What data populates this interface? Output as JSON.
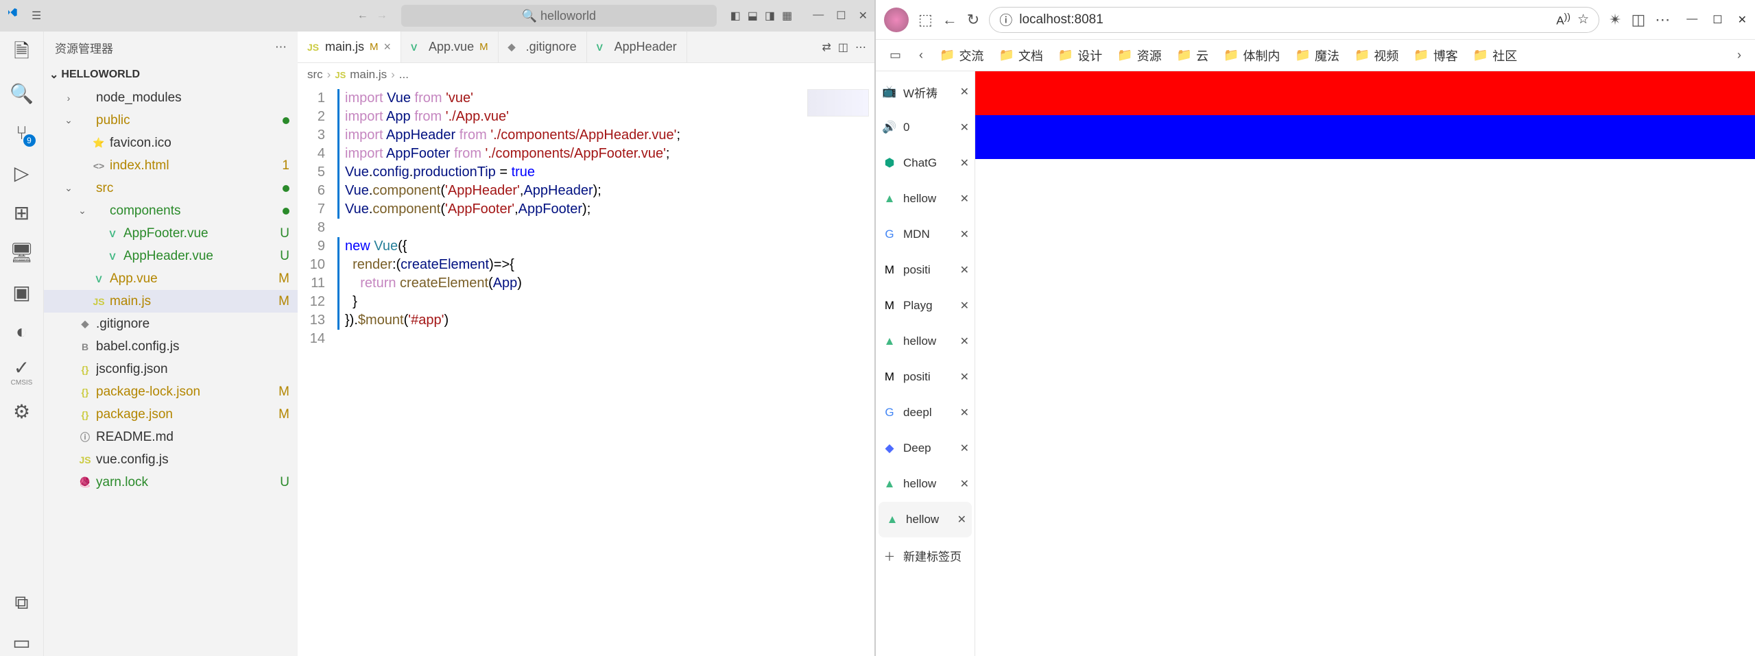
{
  "vscode": {
    "titlebar": {
      "search_placeholder": "helloworld"
    },
    "sidebar": {
      "title": "资源管理器",
      "root": "HELLOWORLD",
      "tree": [
        {
          "indent": 1,
          "chev": "right",
          "icon": "",
          "label": "node_modules",
          "badge": "",
          "class": ""
        },
        {
          "indent": 1,
          "chev": "down",
          "icon": "",
          "label": "public",
          "badge": "dot",
          "class": "git-m"
        },
        {
          "indent": 2,
          "chev": "",
          "icon": "⭐",
          "label": "favicon.ico",
          "badge": "",
          "class": ""
        },
        {
          "indent": 2,
          "chev": "",
          "icon": "<>",
          "label": "index.html",
          "badge": "1",
          "class": "git-m"
        },
        {
          "indent": 1,
          "chev": "down",
          "icon": "",
          "label": "src",
          "badge": "dot",
          "class": "git-m"
        },
        {
          "indent": 2,
          "chev": "down",
          "icon": "",
          "label": "components",
          "badge": "dot",
          "class": "git-u"
        },
        {
          "indent": 3,
          "chev": "",
          "icon": "V",
          "label": "AppFooter.vue",
          "badge": "U",
          "class": "git-u"
        },
        {
          "indent": 3,
          "chev": "",
          "icon": "V",
          "label": "AppHeader.vue",
          "badge": "U",
          "class": "git-u"
        },
        {
          "indent": 2,
          "chev": "",
          "icon": "V",
          "label": "App.vue",
          "badge": "M",
          "class": "git-m"
        },
        {
          "indent": 2,
          "chev": "",
          "icon": "JS",
          "label": "main.js",
          "badge": "M",
          "class": "git-m",
          "selected": true
        },
        {
          "indent": 1,
          "chev": "",
          "icon": "◆",
          "label": ".gitignore",
          "badge": "",
          "class": ""
        },
        {
          "indent": 1,
          "chev": "",
          "icon": "B",
          "label": "babel.config.js",
          "badge": "",
          "class": ""
        },
        {
          "indent": 1,
          "chev": "",
          "icon": "{}",
          "label": "jsconfig.json",
          "badge": "",
          "class": ""
        },
        {
          "indent": 1,
          "chev": "",
          "icon": "{}",
          "label": "package-lock.json",
          "badge": "M",
          "class": "git-m"
        },
        {
          "indent": 1,
          "chev": "",
          "icon": "{}",
          "label": "package.json",
          "badge": "M",
          "class": "git-m"
        },
        {
          "indent": 1,
          "chev": "",
          "icon": "ⓘ",
          "label": "README.md",
          "badge": "",
          "class": ""
        },
        {
          "indent": 1,
          "chev": "",
          "icon": "JS",
          "label": "vue.config.js",
          "badge": "",
          "class": ""
        },
        {
          "indent": 1,
          "chev": "",
          "icon": "🧶",
          "label": "yarn.lock",
          "badge": "U",
          "class": "git-u"
        }
      ]
    },
    "activity_badge": "9",
    "tabs": [
      {
        "icon": "JS",
        "icon_color": "#cbcb41",
        "label": "main.js",
        "status": "M",
        "close": true,
        "active": true
      },
      {
        "icon": "V",
        "icon_color": "#41b883",
        "label": "App.vue",
        "status": "M",
        "close": false,
        "active": false
      },
      {
        "icon": "◆",
        "icon_color": "#888",
        "label": ".gitignore",
        "status": "",
        "close": false,
        "active": false
      },
      {
        "icon": "V",
        "icon_color": "#41b883",
        "label": "AppHeader",
        "status": "",
        "close": false,
        "active": false,
        "overflow": true
      }
    ],
    "breadcrumb": [
      "src",
      "main.js",
      "..."
    ],
    "breadcrumb_icons": [
      "",
      "JS",
      ""
    ],
    "code": {
      "lines": [
        {
          "n": 1,
          "mod": true,
          "html": "<span class='tok-kw'>import</span> <span class='tok-var'>Vue</span> <span class='tok-kw'>from</span> <span class='tok-str'>'vue'</span>"
        },
        {
          "n": 2,
          "mod": true,
          "html": "<span class='tok-kw'>import</span> <span class='tok-var'>App</span> <span class='tok-kw'>from</span> <span class='tok-str'>'./App.vue'</span>"
        },
        {
          "n": 3,
          "mod": true,
          "html": "<span class='tok-kw'>import</span> <span class='tok-var'>AppHeader</span> <span class='tok-kw'>from</span> <span class='tok-str'>'./components/AppHeader.vue'</span>;"
        },
        {
          "n": 4,
          "mod": true,
          "html": "<span class='tok-kw'>import</span> <span class='tok-var'>AppFooter</span> <span class='tok-kw'>from</span> <span class='tok-str'>'./components/AppFooter.vue'</span>;"
        },
        {
          "n": 5,
          "mod": true,
          "html": "<span class='tok-var'>Vue</span>.<span class='tok-prop'>config</span>.<span class='tok-prop'>productionTip</span> = <span class='tok-bool'>true</span>"
        },
        {
          "n": 6,
          "mod": true,
          "html": "<span class='tok-var'>Vue</span>.<span class='tok-fn'>component</span>(<span class='tok-str'>'AppHeader'</span>,<span class='tok-var'>AppHeader</span>);"
        },
        {
          "n": 7,
          "mod": true,
          "html": "<span class='tok-var'>Vue</span>.<span class='tok-fn'>component</span>(<span class='tok-str'>'AppFooter'</span>,<span class='tok-var'>AppFooter</span>);"
        },
        {
          "n": 8,
          "mod": false,
          "html": ""
        },
        {
          "n": 9,
          "mod": true,
          "html": "<span class='tok-new'>new</span> <span class='tok-mod'>Vue</span>({"
        },
        {
          "n": 10,
          "mod": true,
          "html": "  <span class='tok-fn'>render</span>:(<span class='tok-var'>createElement</span>)=&gt;{"
        },
        {
          "n": 11,
          "mod": true,
          "html": "    <span class='tok-kw'>return</span> <span class='tok-fn'>createElement</span>(<span class='tok-var'>App</span>)"
        },
        {
          "n": 12,
          "mod": true,
          "html": "  }"
        },
        {
          "n": 13,
          "mod": true,
          "html": "}).<span class='tok-fn'>$mount</span>(<span class='tok-str'>'#app'</span>)"
        },
        {
          "n": 14,
          "mod": false,
          "html": ""
        }
      ]
    }
  },
  "browser": {
    "url": "localhost:8081",
    "bookmarks": [
      "交流",
      "文档",
      "设计",
      "资源",
      "云",
      "体制内",
      "魔法",
      "视频",
      "博客",
      "社区"
    ],
    "vtabs": [
      {
        "icon": "📺",
        "color": "#00a1d6",
        "label": "W祈祷"
      },
      {
        "icon": "🔊",
        "color": "#00a1d6",
        "label": "0"
      },
      {
        "icon": "⬢",
        "color": "#10a37f",
        "label": "ChatG"
      },
      {
        "icon": "▲",
        "color": "#41b883",
        "label": "hellow"
      },
      {
        "icon": "G",
        "color": "#4285f4",
        "label": "MDN"
      },
      {
        "icon": "M",
        "color": "#000",
        "label": "positi"
      },
      {
        "icon": "M",
        "color": "#000",
        "label": "Playg"
      },
      {
        "icon": "▲",
        "color": "#41b883",
        "label": "hellow"
      },
      {
        "icon": "M",
        "color": "#000",
        "label": "positi"
      },
      {
        "icon": "G",
        "color": "#4285f4",
        "label": "deepl"
      },
      {
        "icon": "◆",
        "color": "#4d6bfe",
        "label": "Deep"
      },
      {
        "icon": "▲",
        "color": "#41b883",
        "label": "hellow"
      },
      {
        "icon": "▲",
        "color": "#41b883",
        "label": "hellow",
        "active": true
      }
    ],
    "newtab_label": "新建标签页"
  }
}
